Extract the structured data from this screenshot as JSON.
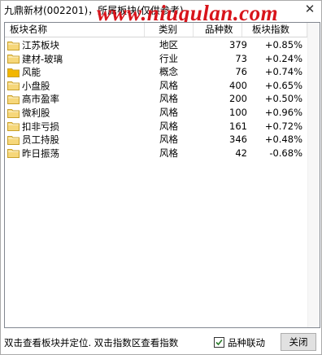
{
  "window": {
    "title": "九鼎新材(002201)，所属板块(仅供参考)",
    "watermark": "www.niugulan.com",
    "close_glyph": "✕"
  },
  "table": {
    "columns": [
      "板块名称",
      "类别",
      "品种数",
      "板块指数"
    ],
    "rows": [
      {
        "name": "江苏板块",
        "type": "地区",
        "count": "379",
        "index": "+0.85%",
        "icon": "folder-icon"
      },
      {
        "name": "建材-玻璃",
        "type": "行业",
        "count": "73",
        "index": "+0.24%",
        "icon": "folder-icon"
      },
      {
        "name": "风能",
        "type": "概念",
        "count": "76",
        "index": "+0.74%",
        "icon": "folder-icon-filled"
      },
      {
        "name": "小盘股",
        "type": "风格",
        "count": "400",
        "index": "+0.65%",
        "icon": "folder-icon"
      },
      {
        "name": "高市盈率",
        "type": "风格",
        "count": "200",
        "index": "+0.50%",
        "icon": "folder-icon"
      },
      {
        "name": "微利股",
        "type": "风格",
        "count": "100",
        "index": "+0.96%",
        "icon": "folder-icon"
      },
      {
        "name": "扣非亏损",
        "type": "风格",
        "count": "161",
        "index": "+0.72%",
        "icon": "folder-icon"
      },
      {
        "name": "员工持股",
        "type": "风格",
        "count": "346",
        "index": "+0.48%",
        "icon": "folder-icon"
      },
      {
        "name": "昨日振荡",
        "type": "风格",
        "count": "42",
        "index": "-0.68%",
        "icon": "folder-icon"
      }
    ]
  },
  "footer": {
    "hint": "双击查看板块并定位. 双击指数区查看指数",
    "checkbox_label": "品种联动",
    "checkbox_checked": true,
    "close_button": "关闭"
  },
  "colors": {
    "watermark": "#d8141b",
    "folder_fill": "#f6d77a",
    "folder_filled": "#f2b600",
    "folder_stroke": "#c9a12a",
    "check": "#2a7d2a"
  }
}
